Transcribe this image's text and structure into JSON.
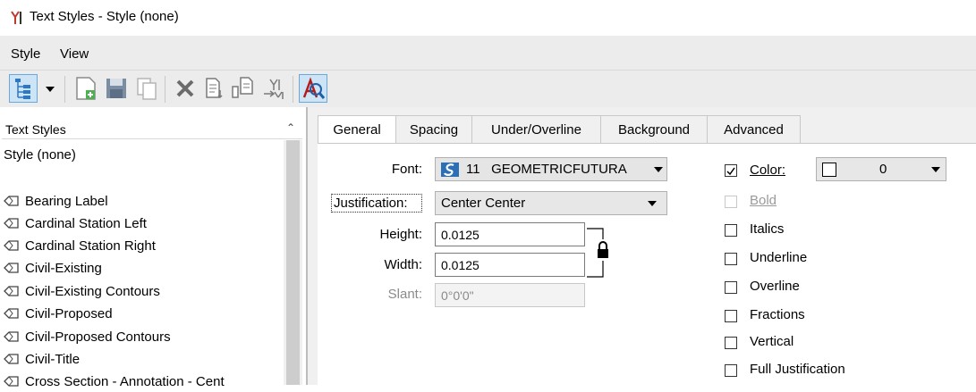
{
  "window": {
    "title": "Text Styles - Style (none)"
  },
  "menu": {
    "items": [
      "Style",
      "View"
    ]
  },
  "toolbar": {
    "buttons": [
      "tree-view-icon",
      "dropdown-arrow-icon",
      "new-style-icon",
      "save-icon",
      "copy-icon",
      "delete-icon",
      "import-icon",
      "export-icon",
      "create-from-element-icon",
      "preview-icon"
    ]
  },
  "list": {
    "header": "Text Styles",
    "items": [
      "Style (none)",
      "Bearing Label",
      "Cardinal Station Left",
      "Cardinal Station Right",
      "Civil-Existing",
      "Civil-Existing Contours",
      "Civil-Proposed",
      "Civil-Proposed Contours",
      "Civil-Title",
      "Cross Section - Annotation - Cent"
    ]
  },
  "tabs": [
    "General",
    "Spacing",
    "Under/Overline",
    "Background",
    "Advanced"
  ],
  "general": {
    "font_label": "Font:",
    "font_value": "11   GEOMETRICFUTURA",
    "justification_label": "Justification:",
    "justification_value": "Center Center",
    "height_label": "Height:",
    "height_value": "0.0125",
    "width_label": "Width:",
    "width_value": "0.0125",
    "slant_label": "Slant:",
    "slant_value": "0°0'0\""
  },
  "options": {
    "color_label": "Color:",
    "color_value": "0",
    "color_checked": true,
    "checkboxes": [
      "Bold",
      "Italics",
      "Underline",
      "Overline",
      "Fractions",
      "Vertical",
      "Full Justification"
    ]
  }
}
